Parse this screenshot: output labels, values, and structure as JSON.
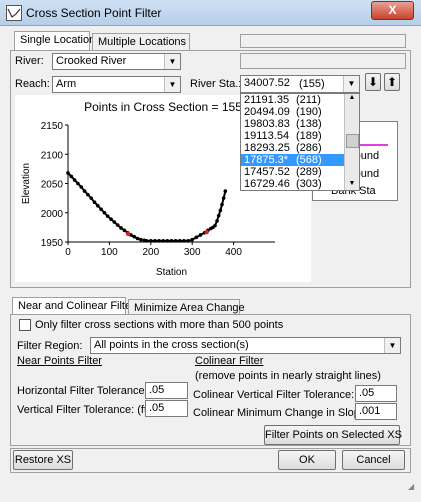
{
  "window": {
    "title": "Cross Section Point Filter",
    "close": "X"
  },
  "top_tabs": [
    "Single Location",
    "Multiple Locations"
  ],
  "river": {
    "label": "River:",
    "value": "Crooked River"
  },
  "reach": {
    "label": "Reach:",
    "value": "Arm"
  },
  "river_sta": {
    "label": "River Sta.:",
    "value": "34007.52",
    "count": "(155)"
  },
  "arrows": {
    "down": "⬇",
    "up": "⬆"
  },
  "dropdown_items": [
    {
      "sta": "21191.35",
      "count": "(211)"
    },
    {
      "sta": "20494.09",
      "count": "(190)"
    },
    {
      "sta": "19803.83",
      "count": "(138)"
    },
    {
      "sta": "19113.54",
      "count": "(189)"
    },
    {
      "sta": "18293.25",
      "count": "(286)"
    },
    {
      "sta": "17875.3*",
      "count": "(568)",
      "selected": true
    },
    {
      "sta": "17457.52",
      "count": "(289)"
    },
    {
      "sta": "16729.46",
      "count": "(303)"
    }
  ],
  "legend": {
    "items": [
      "d",
      "round",
      "round",
      "Bank Sta"
    ],
    "line_color": "#e040e0"
  },
  "chart_data": {
    "type": "scatter",
    "title": "Points in Cross Section = 155",
    "xlabel": "Station",
    "ylabel": "Elevation",
    "xlim": [
      0,
      500
    ],
    "ylim": [
      1950,
      2150
    ],
    "xticks": [
      0,
      100,
      200,
      300,
      400
    ],
    "yticks": [
      1950,
      2000,
      2050,
      2100,
      2150
    ],
    "series": [
      {
        "color": "#000000",
        "x": [
          0,
          8,
          16,
          24,
          32,
          40,
          48,
          56,
          64,
          72,
          80,
          88,
          96,
          104,
          112,
          120,
          128,
          136,
          144,
          152,
          160,
          168,
          176,
          184,
          190,
          200,
          210,
          220,
          230,
          240,
          250,
          260,
          270,
          280,
          290,
          300,
          310,
          320,
          330,
          338,
          345,
          350,
          355,
          360,
          364,
          368,
          372,
          376,
          380
        ],
        "y": [
          2068,
          2062,
          2056,
          2050,
          2044,
          2037,
          2031,
          2025,
          2018,
          2012,
          2006,
          2000,
          1994,
          1989,
          1984,
          1979,
          1974,
          1970,
          1966,
          1962,
          1959,
          1956,
          1954,
          1953,
          1952,
          1952,
          1952,
          1952,
          1952,
          1952,
          1952,
          1952,
          1952,
          1952,
          1952,
          1954,
          1958,
          1962,
          1966,
          1970,
          1973,
          1975,
          1978,
          1986,
          1995,
          2004,
          2014,
          2025,
          2037
        ]
      },
      {
        "name": "Bank Sta",
        "color": "#e02020",
        "x": [
          145,
          335
        ],
        "y": [
          1964,
          1967
        ]
      }
    ]
  },
  "bottom_tabs": [
    "Near and Colinear Filter",
    "Minimize Area Change"
  ],
  "checkbox_label": "Only filter cross sections with more than 500 points",
  "filter_region": {
    "label": "Filter Region:",
    "value": "All points in the cross section(s)"
  },
  "near_points": {
    "heading": "Near Points Filter",
    "horizontal_label": "Horizontal Filter Tolerance: (ft):",
    "horizontal_value": ".05",
    "vertical_label": "Vertical Filter Tolerance: (ft):",
    "vertical_value": ".05"
  },
  "colinear": {
    "heading": "Colinear Filter",
    "note": "(remove points in nearly straight lines)",
    "vertical_label": "Colinear Vertical Filter Tolerance: (ft):",
    "vertical_value": ".05",
    "slope_label": "Colinear Minimum Change in Slope:",
    "slope_value": ".001"
  },
  "buttons": {
    "filter": "Filter Points on Selected XS",
    "restore": "Restore XS",
    "ok": "OK",
    "cancel": "Cancel"
  }
}
